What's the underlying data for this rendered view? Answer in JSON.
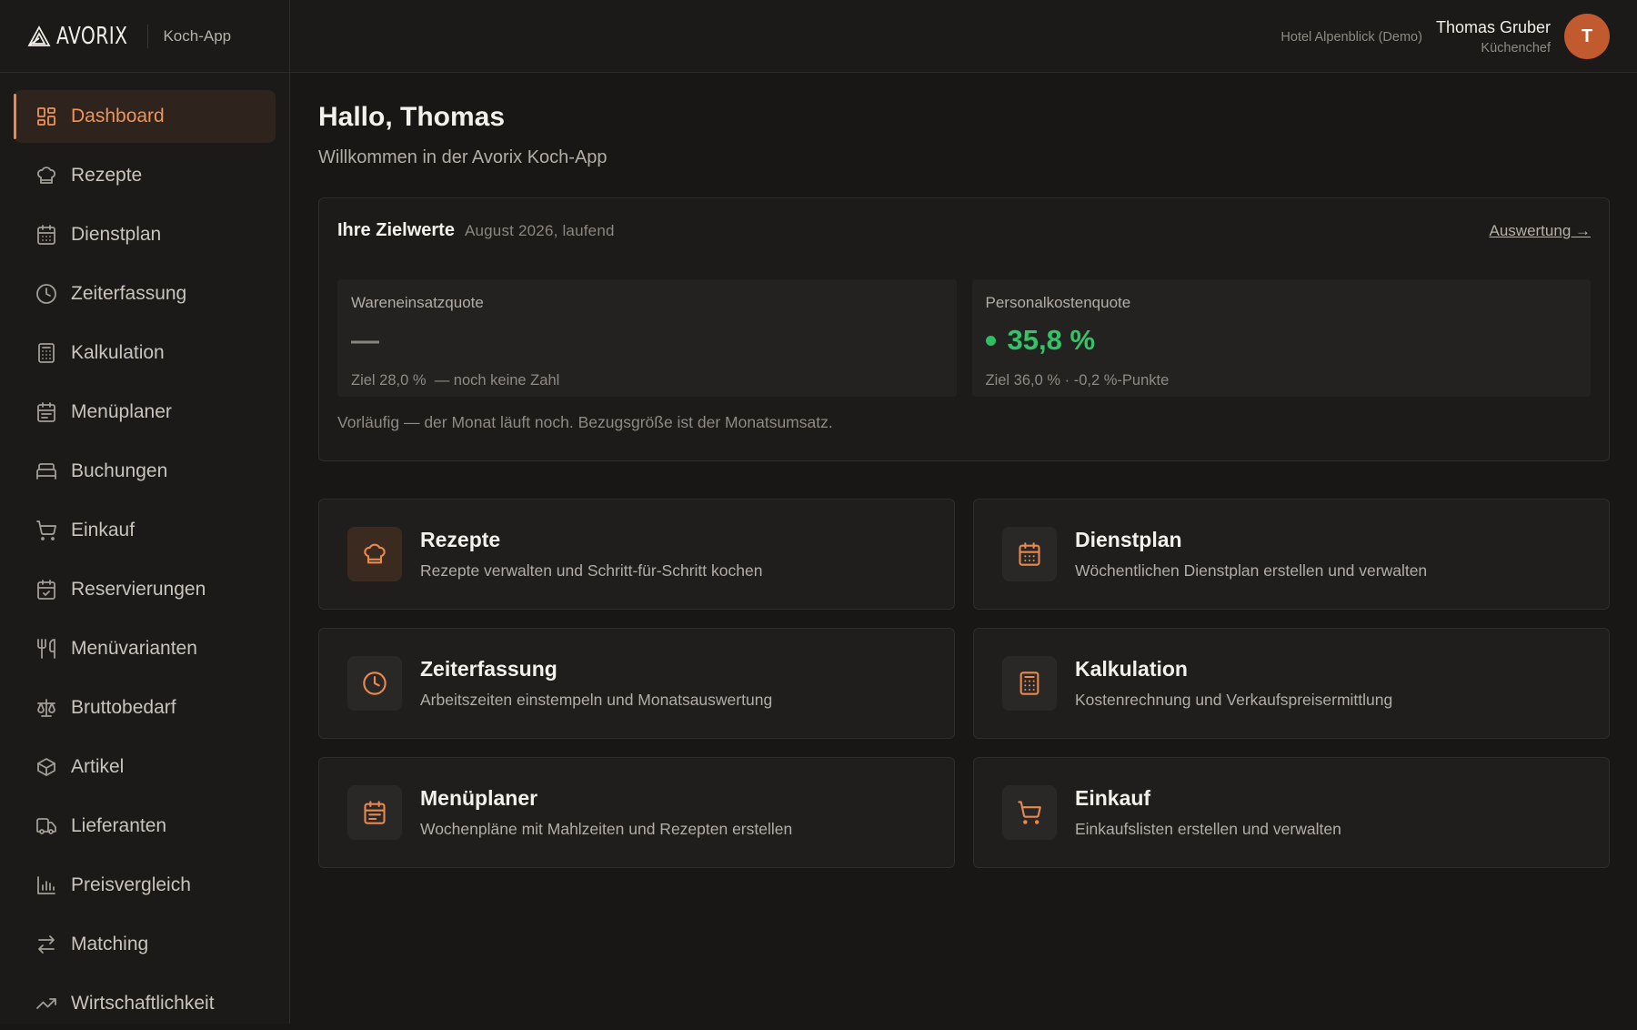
{
  "brand": {
    "logo_text": "AVORIX",
    "app_name": "Koch-App"
  },
  "user": {
    "hotel": "Hotel Alpenblick (Demo)",
    "name": "Thomas Gruber",
    "role": "Küchenchef",
    "initial": "T"
  },
  "sidebar": {
    "items": [
      {
        "label": "Dashboard",
        "icon": "dashboard-icon",
        "active": true
      },
      {
        "label": "Rezepte",
        "icon": "chef-hat-icon"
      },
      {
        "label": "Dienstplan",
        "icon": "calendar-icon"
      },
      {
        "label": "Zeiterfassung",
        "icon": "clock-icon"
      },
      {
        "label": "Kalkulation",
        "icon": "calculator-icon"
      },
      {
        "label": "Menüplaner",
        "icon": "calendar-list-icon"
      },
      {
        "label": "Buchungen",
        "icon": "bed-icon"
      },
      {
        "label": "Einkauf",
        "icon": "cart-icon"
      },
      {
        "label": "Reservierungen",
        "icon": "calendar-check-icon"
      },
      {
        "label": "Menüvarianten",
        "icon": "utensils-icon"
      },
      {
        "label": "Bruttobedarf",
        "icon": "scale-icon"
      },
      {
        "label": "Artikel",
        "icon": "package-icon"
      },
      {
        "label": "Lieferanten",
        "icon": "truck-icon"
      },
      {
        "label": "Preisvergleich",
        "icon": "bar-chart-icon"
      },
      {
        "label": "Matching",
        "icon": "arrows-icon"
      },
      {
        "label": "Wirtschaftlichkeit",
        "icon": "trend-icon"
      }
    ]
  },
  "main": {
    "greeting": "Hallo, Thomas",
    "subtitle": "Willkommen in der Avorix Koch-App",
    "targets": {
      "title": "Ihre Zielwerte",
      "period": "August 2026, laufend",
      "link": "Auswertung →",
      "kpis": [
        {
          "label": "Wareneinsatzquote",
          "value": "—",
          "foot": "Ziel 28,0 %  — noch keine Zahl"
        },
        {
          "label": "Personalkostenquote",
          "value": "35,8 %",
          "foot": "Ziel 36,0 % · -0,2 %-Punkte",
          "status_color": "#2fbe63"
        }
      ],
      "note": "Vorläufig — der Monat läuft noch. Bezugsgröße ist der Monatsumsatz."
    },
    "cards": [
      {
        "title": "Rezepte",
        "desc": "Rezepte verwalten und Schritt-für-Schritt kochen",
        "icon": "chef-hat-icon"
      },
      {
        "title": "Dienstplan",
        "desc": "Wöchentlichen Dienstplan erstellen und verwalten",
        "icon": "calendar-icon"
      },
      {
        "title": "Zeiterfassung",
        "desc": "Arbeitszeiten einstempeln und Monatsauswertung",
        "icon": "clock-icon"
      },
      {
        "title": "Kalkulation",
        "desc": "Kostenrechnung und Verkaufspreisermittlung",
        "icon": "calculator-icon"
      },
      {
        "title": "Menüplaner",
        "desc": "Wochenpläne mit Mahlzeiten und Rezepten erstellen",
        "icon": "calendar-list-icon"
      },
      {
        "title": "Einkauf",
        "desc": "Einkaufslisten erstellen und verwalten",
        "icon": "cart-icon"
      }
    ]
  },
  "colors": {
    "accent": "#e8894f",
    "avatar": "#c25a2f",
    "good": "#33c46a"
  }
}
